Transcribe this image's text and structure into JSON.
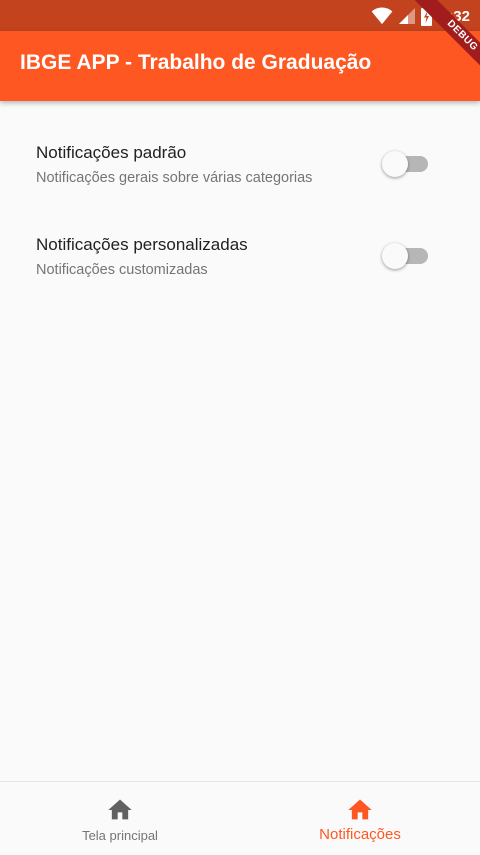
{
  "status_bar": {
    "time": "8:32"
  },
  "app_bar": {
    "title": "IBGE APP - Trabalho de Graduação"
  },
  "debug_banner": {
    "label": "DEBUG"
  },
  "settings": [
    {
      "title": "Notificações padrão",
      "subtitle": "Notificações gerais sobre várias categorias",
      "enabled": false
    },
    {
      "title": "Notificações personalizadas",
      "subtitle": "Notificações customizadas",
      "enabled": false
    }
  ],
  "bottom_nav": {
    "items": [
      {
        "label": "Tela principal",
        "icon": "home-icon",
        "active": false
      },
      {
        "label": "Notificações",
        "icon": "home-icon",
        "active": true
      }
    ]
  },
  "colors": {
    "primary": "#ff5722",
    "status_bar": "#c2431e",
    "debug_banner": "#a11d1d",
    "inactive_icon": "#616161",
    "switch_track_off": "#b6b6b6"
  }
}
